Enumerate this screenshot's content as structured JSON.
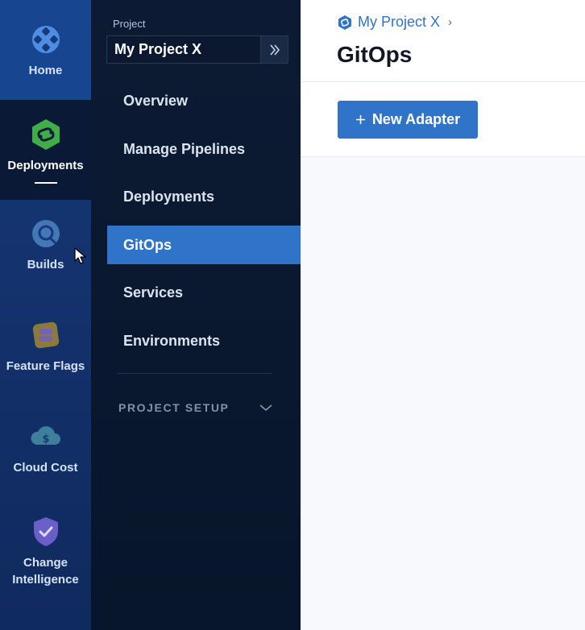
{
  "modules": [
    {
      "key": "home",
      "label": "Home",
      "icon": "home-icon"
    },
    {
      "key": "deployments",
      "label": "Deployments",
      "icon": "deployments-icon",
      "active": true
    },
    {
      "key": "builds",
      "label": "Builds",
      "icon": "builds-icon"
    },
    {
      "key": "feature_flags",
      "label": "Feature Flags",
      "icon": "feature-flags-icon"
    },
    {
      "key": "cloud_cost",
      "label": "Cloud Cost",
      "icon": "cloud-cost-icon"
    },
    {
      "key": "change_intelligence",
      "label": "Change Intelligence",
      "label_lines": [
        "Change",
        "Intelligence"
      ],
      "icon": "change-intelligence-icon"
    }
  ],
  "project": {
    "label": "Project",
    "name": "My Project X",
    "expand_icon": "double-chevron-right-icon"
  },
  "nav": {
    "items": [
      {
        "label": "Overview"
      },
      {
        "label": "Manage Pipelines"
      },
      {
        "label": "Deployments"
      },
      {
        "label": "GitOps",
        "active": true
      },
      {
        "label": "Services"
      },
      {
        "label": "Environments"
      }
    ],
    "section": {
      "label": "PROJECT SETUP",
      "icon": "chevron-down-icon"
    }
  },
  "header": {
    "breadcrumb": {
      "label": "My Project X",
      "icon": "project-icon",
      "separator": "›"
    },
    "title": "GitOps"
  },
  "toolbar": {
    "new_adapter": {
      "label": "New Adapter",
      "icon": "plus-icon"
    }
  },
  "colors": {
    "accent": "#2f74c9",
    "rail": "#13306a",
    "nav_bg": "#0c1a33",
    "deployments_green": "#3fae49"
  }
}
